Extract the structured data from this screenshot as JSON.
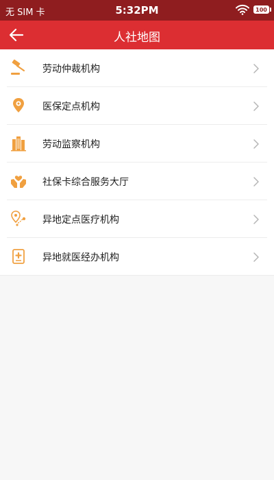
{
  "status_bar": {
    "carrier": "无 SIM 卡",
    "time": "5:32PM",
    "battery": "100"
  },
  "header": {
    "title": "人社地图",
    "back_icon": "arrow-left-icon"
  },
  "accent_color": "#dc2e32",
  "icon_color": "#f0a040",
  "items": [
    {
      "label": "劳动仲裁机构",
      "icon": "gavel-icon"
    },
    {
      "label": "医保定点机构",
      "icon": "location-pin-icon"
    },
    {
      "label": "劳动监察机构",
      "icon": "building-icon"
    },
    {
      "label": "社保卡综合服务大厅",
      "icon": "hands-heart-icon"
    },
    {
      "label": "异地定点医疗机构",
      "icon": "route-pin-icon"
    },
    {
      "label": "异地就医经办机构",
      "icon": "medical-document-icon"
    }
  ]
}
